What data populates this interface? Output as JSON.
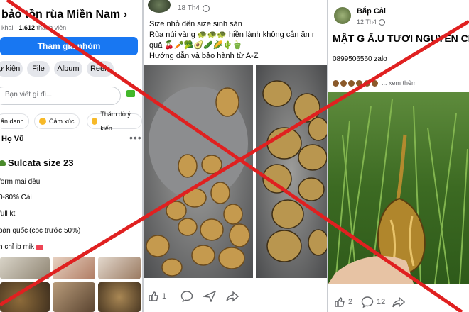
{
  "left_panel": {
    "group_name": "bảo tồn rùa Miền Nam",
    "chevron": "›",
    "member_prefix": "khai · ",
    "member_count": "1.612",
    "member_suffix": " thành viên",
    "join_label": "Tham gia nhóm",
    "tabs": [
      "ự kiện",
      "File",
      "Album",
      "Reels"
    ],
    "composer_placeholder": "Bạn viết gì đi...",
    "actions": [
      "ẩn danh",
      "Cảm xúc",
      "Thăm dò ý kiến"
    ],
    "author": "Họ Vũ",
    "more_icon": "more-icon",
    "post_lines": [
      "Sulcata size 23",
      "form mai đều",
      "0-80% Cái",
      "full ktl",
      "oàn quốc (coc trước 50%)",
      "n chỉ ib mik"
    ]
  },
  "middle_panel": {
    "date": "18 Th4",
    "post_lines": [
      "Size nhỏ đến size sinh sản",
      "Rùa núi vàng 🐢🐢🐢 hiền lành không cắn ăn r",
      "quả 🍒🥕🥦🥑🥒🌽🌵🫑",
      "Hướng dẫn và bảo hành từ A-Z"
    ],
    "footer_icons": [
      "like-icon",
      "comment-icon",
      "send-icon",
      "share-icon"
    ]
  },
  "right_panel": {
    "author": "Bắp Cải",
    "date": "12 Th4",
    "headline": "MẬT G   Ấ.U TƯƠI NGUYÊN CHI",
    "phone_line": "0899506560 zalo",
    "see_more": "... xem thêm",
    "like_count": "2",
    "comment_count": "12"
  },
  "colors": {
    "facebook_blue": "#1877f2",
    "cross_red": "#e02020",
    "icon_gray": "#65676b"
  }
}
